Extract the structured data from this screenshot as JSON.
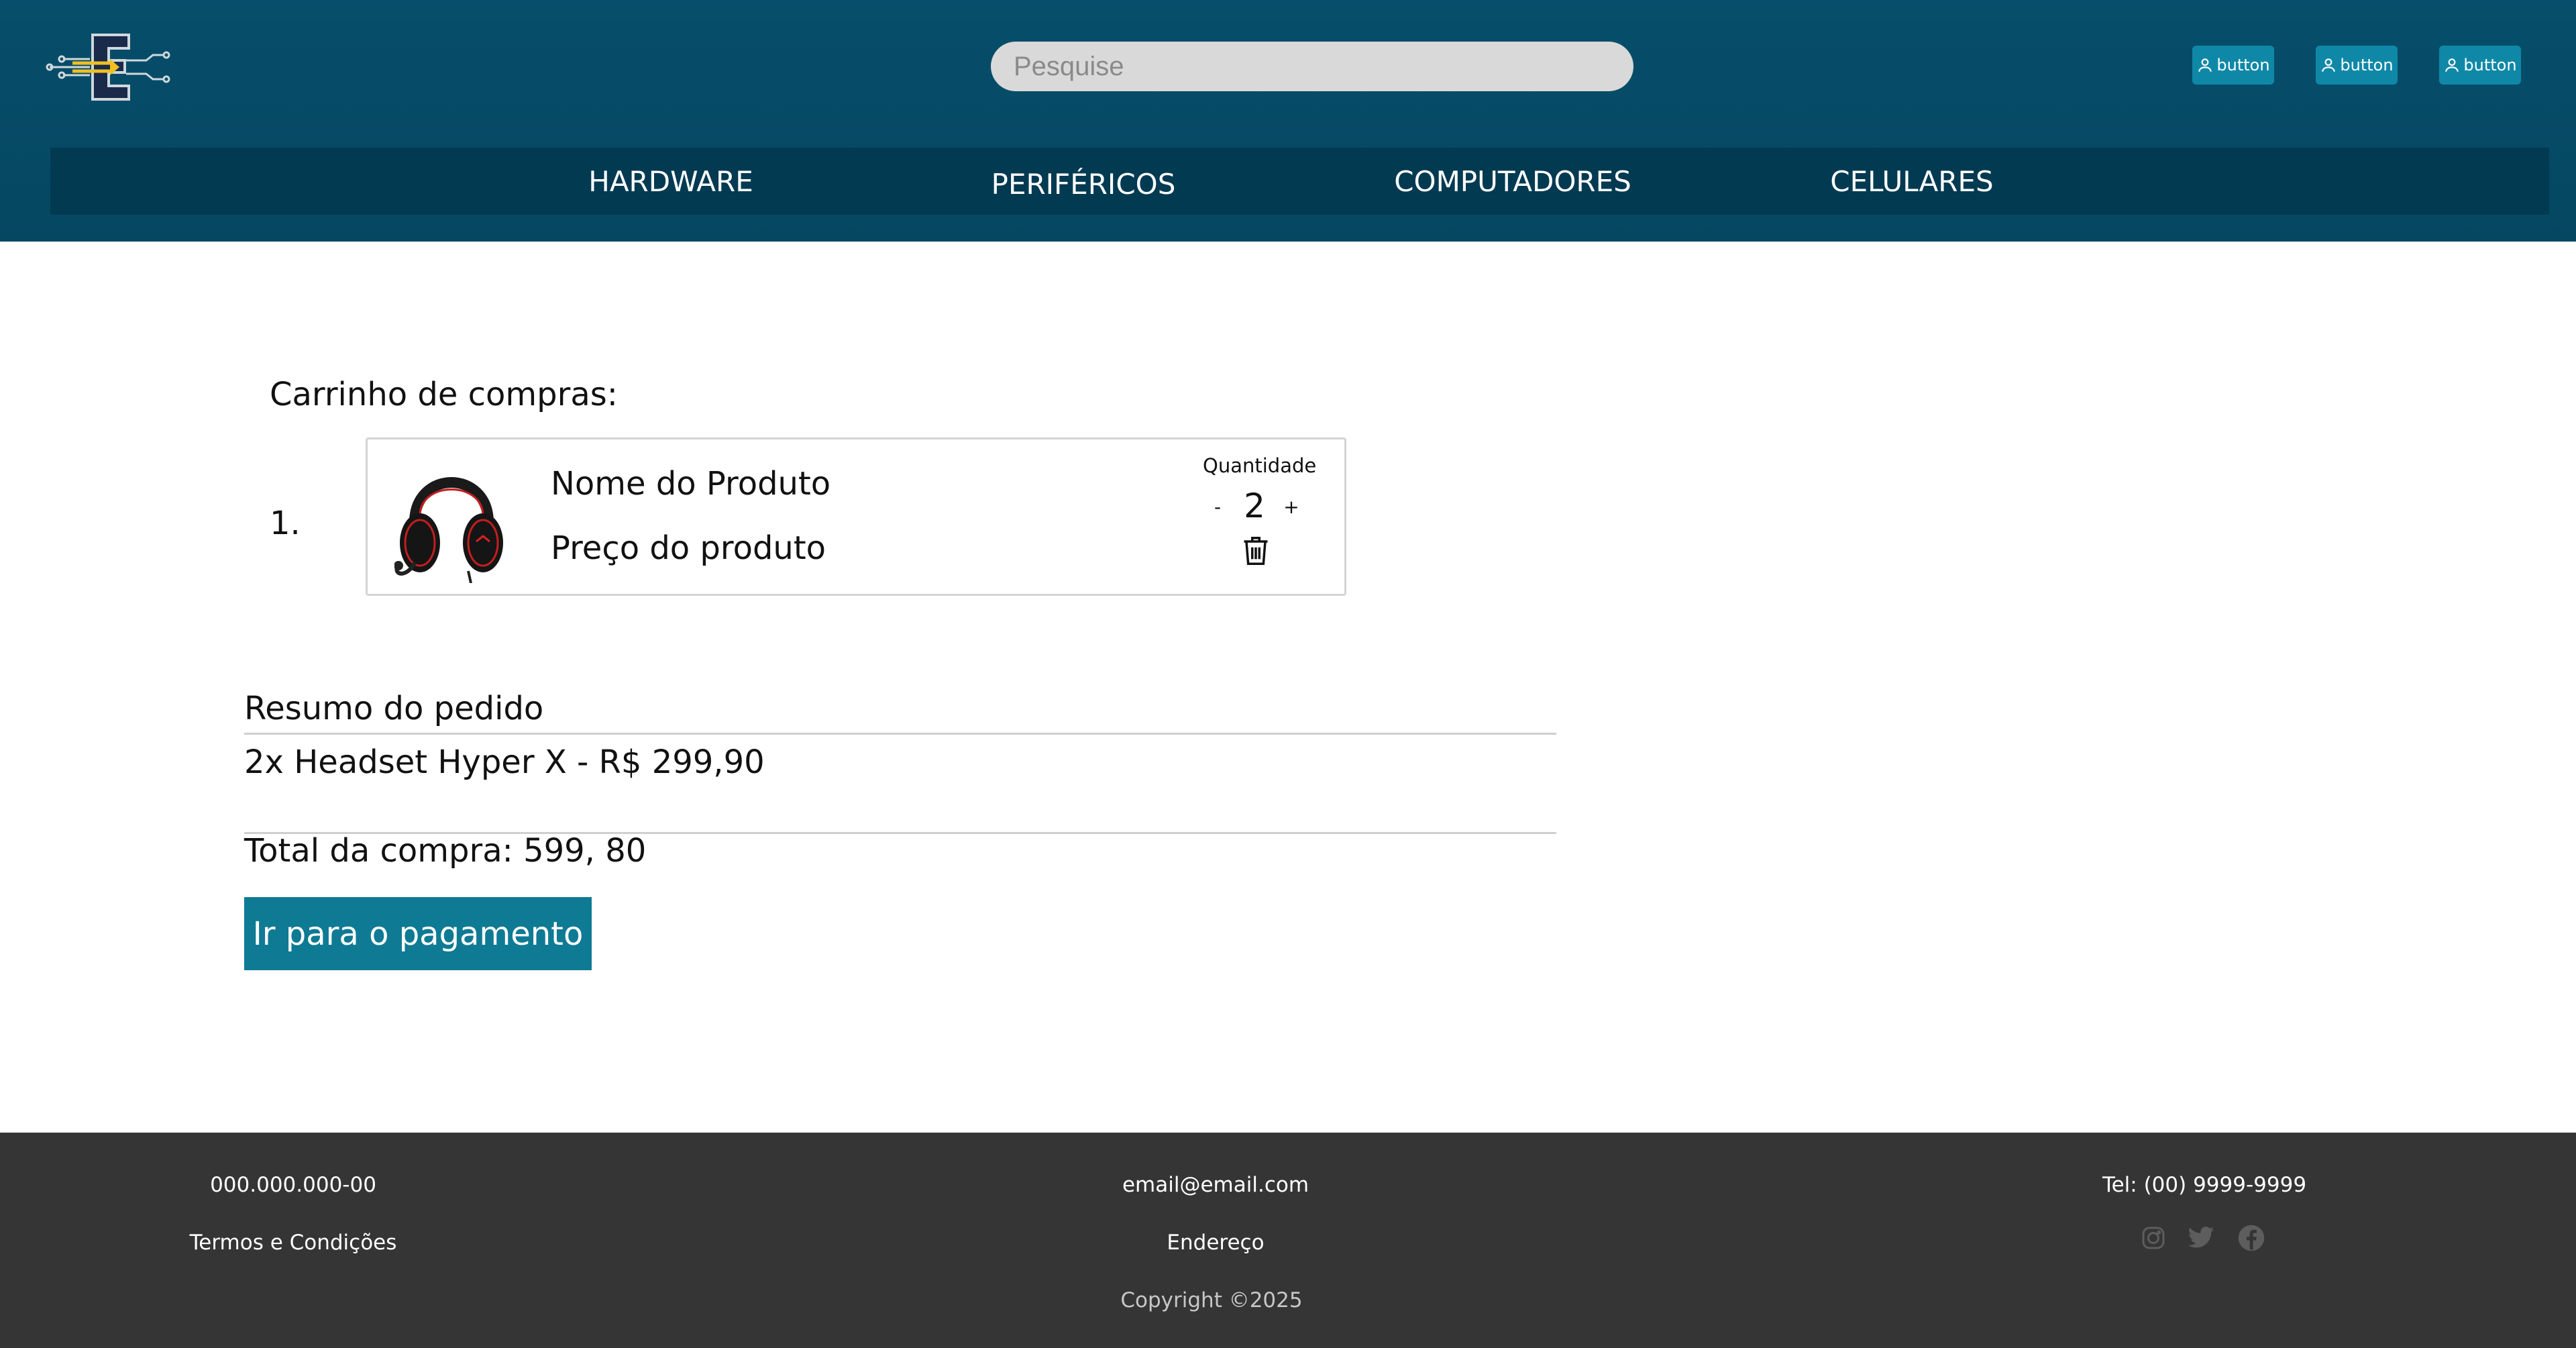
{
  "header": {
    "logo_icon": "circuit-letter-e-logo",
    "search": {
      "placeholder": "Pesquise",
      "value": ""
    },
    "buttons": [
      {
        "label": "button",
        "icon": "user-icon"
      },
      {
        "label": "button",
        "icon": "user-icon"
      },
      {
        "label": "button",
        "icon": "user-icon"
      }
    ],
    "nav": [
      "HARDWARE",
      "PERIFÉRICOS",
      "COMPUTADORES",
      "CELULARES"
    ]
  },
  "cart": {
    "title": "Carrinho de compras:",
    "items": [
      {
        "index": "1.",
        "name": "Nome do Produto",
        "price": "Preço do produto",
        "quantity_label": "Quantidade",
        "decrement": "-",
        "quantity": "2",
        "increment": "+",
        "image_icon": "headset-icon",
        "remove_icon": "trash-icon"
      }
    ]
  },
  "summary": {
    "title": "Resumo do pedido",
    "line": "2x Headset Hyper X - R$ 299,90",
    "total": "Total da compra: 599, 80",
    "pay_button": "Ir para o pagamento"
  },
  "footer": {
    "cnpj": "000.000.000-00",
    "terms": "Termos e Condições",
    "email": "email@email.com",
    "address": "Endereço",
    "copyright": "Copyright ©2025",
    "phone": "Tel: (00) 9999-9999",
    "social_icons": [
      "instagram-icon",
      "twitter-icon",
      "facebook-icon"
    ]
  },
  "colors": {
    "header_bg": "#064e6b",
    "nav_bg": "#023a52",
    "accent": "#0f7a93",
    "header_button": "#0f88a8",
    "footer_bg": "#353535"
  }
}
